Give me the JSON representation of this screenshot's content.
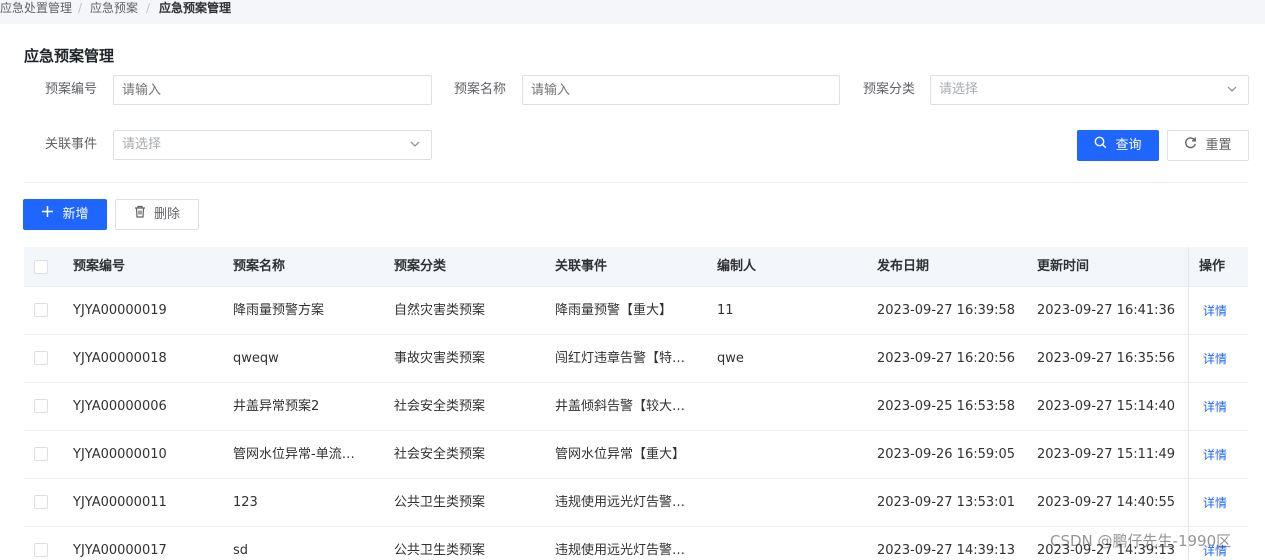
{
  "breadcrumb": {
    "items": [
      "应急处置管理",
      "应急预案",
      "应急预案管理"
    ],
    "separator": "/"
  },
  "page": {
    "title": "应急预案管理"
  },
  "filters": {
    "plan_code": {
      "label": "预案编号",
      "placeholder": "请输入"
    },
    "plan_name": {
      "label": "预案名称",
      "placeholder": "请输入"
    },
    "plan_category": {
      "label": "预案分类",
      "placeholder": "请选择"
    },
    "related_event": {
      "label": "关联事件",
      "placeholder": "请选择"
    }
  },
  "actions": {
    "query_label": "查询",
    "reset_label": "重置",
    "add_label": "新增",
    "delete_label": "删除"
  },
  "table": {
    "columns": [
      "预案编号",
      "预案名称",
      "预案分类",
      "关联事件",
      "编制人",
      "发布日期",
      "更新时间",
      "操作"
    ],
    "rows": [
      {
        "code": "YJYA00000019",
        "name": "降雨量预警方案",
        "category": "自然灾害类预案",
        "event": "降雨量预警【重大】",
        "author": "11",
        "published": "2023-09-27 16:39:58",
        "updated": "2023-09-27 16:41:36",
        "action": "详情"
      },
      {
        "code": "YJYA00000018",
        "name": "qweqw",
        "category": "事故灾害类预案",
        "event": "闯红灯违章告警【特…",
        "author": "qwe",
        "published": "2023-09-27 16:20:56",
        "updated": "2023-09-27 16:35:56",
        "action": "详情"
      },
      {
        "code": "YJYA00000006",
        "name": "井盖异常预案2",
        "category": "社会安全类预案",
        "event": "井盖倾斜告警【较大…",
        "author": "",
        "published": "2023-09-25 16:53:58",
        "updated": "2023-09-27 15:14:40",
        "action": "详情"
      },
      {
        "code": "YJYA00000010",
        "name": "管网水位异常-单流…",
        "category": "社会安全类预案",
        "event": "管网水位异常【重大】",
        "author": "",
        "published": "2023-09-26 16:59:05",
        "updated": "2023-09-27 15:11:49",
        "action": "详情"
      },
      {
        "code": "YJYA00000011",
        "name": "123",
        "category": "公共卫生类预案",
        "event": "违规使用远光灯告警…",
        "author": "",
        "published": "2023-09-27 13:53:01",
        "updated": "2023-09-27 14:40:55",
        "action": "详情"
      },
      {
        "code": "YJYA00000017",
        "name": "sd",
        "category": "公共卫生类预案",
        "event": "违规使用远光灯告警…",
        "author": "",
        "published": "2023-09-27 14:39:13",
        "updated": "2023-09-27 14:39:13",
        "action": "详情"
      }
    ]
  },
  "watermark": "CSDN @鹏仔先生-1990区",
  "colors": {
    "primary": "#1f66ff",
    "header_bg": "#f3f6fb",
    "border": "#dcdfe6"
  },
  "icons": [
    "chevron-down-icon",
    "search-icon",
    "refresh-icon",
    "plus-icon",
    "trash-icon"
  ]
}
